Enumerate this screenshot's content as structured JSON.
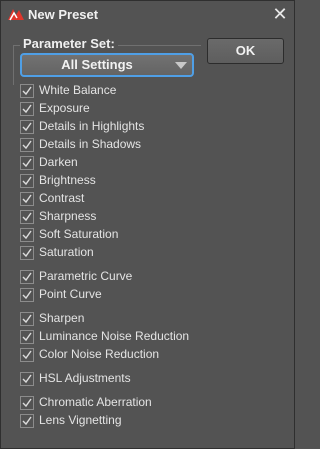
{
  "dialog": {
    "title": "New Preset",
    "close_glyph": "✕",
    "parameter_set_label": "Parameter Set:",
    "parameter_set_value": "All Settings",
    "ok_label": "OK"
  },
  "items": [
    {
      "label": "White Balance",
      "checked": true
    },
    {
      "label": "Exposure",
      "checked": true
    },
    {
      "label": "Details in Highlights",
      "checked": true
    },
    {
      "label": "Details in Shadows",
      "checked": true
    },
    {
      "label": "Darken",
      "checked": true
    },
    {
      "label": "Brightness",
      "checked": true
    },
    {
      "label": "Contrast",
      "checked": true
    },
    {
      "label": "Sharpness",
      "checked": true
    },
    {
      "label": "Soft Saturation",
      "checked": true
    },
    {
      "label": "Saturation",
      "checked": true
    },
    {
      "label": "Parametric Curve",
      "checked": true
    },
    {
      "label": "Point Curve",
      "checked": true
    },
    {
      "label": "Sharpen",
      "checked": true
    },
    {
      "label": "Luminance Noise Reduction",
      "checked": true
    },
    {
      "label": "Color Noise Reduction",
      "checked": true
    },
    {
      "label": "HSL Adjustments",
      "checked": true
    },
    {
      "label": "Chromatic Aberration",
      "checked": true
    },
    {
      "label": "Lens Vignetting",
      "checked": true
    }
  ],
  "colors": {
    "background": "#535353",
    "accent_focus": "#4f9fe6",
    "app_icon_red": "#e0352b"
  },
  "icons": {
    "app": "akvis-app-icon",
    "close": "close-icon",
    "dropdown": "chevron-down-icon",
    "check": "checkmark-icon"
  }
}
